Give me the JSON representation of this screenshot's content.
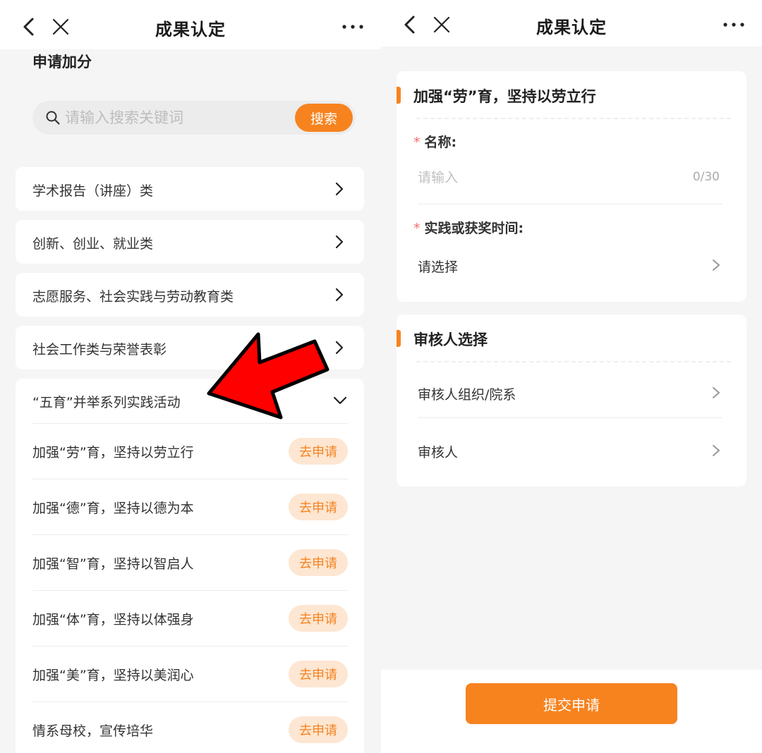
{
  "colors": {
    "accent": "#f7831f",
    "accent_light": "#fde6d2",
    "required": "#f56c6c",
    "annotation": "#ff0000"
  },
  "left": {
    "nav": {
      "title": "成果认定"
    },
    "section_title": "申请加分",
    "search": {
      "placeholder": "请输入搜索关键词",
      "value": "",
      "button_label": "搜索"
    },
    "categories": [
      {
        "label": "学术报告（讲座）类"
      },
      {
        "label": "创新、创业、就业类"
      },
      {
        "label": "志愿服务、社会实践与劳动教育类"
      },
      {
        "label": "社会工作类与荣誉表彰"
      }
    ],
    "expanded_category": {
      "label": "“五育”并举系列实践活动",
      "items": [
        {
          "label": "加强“劳”育，坚持以劳立行",
          "button": "去申请"
        },
        {
          "label": "加强“德”育，坚持以德为本",
          "button": "去申请"
        },
        {
          "label": "加强“智”育，坚持以智启人",
          "button": "去申请"
        },
        {
          "label": "加强“体”育，坚持以体强身",
          "button": "去申请"
        },
        {
          "label": "加强“美”育，坚持以美润心",
          "button": "去申请"
        },
        {
          "label": "情系母校，宣传培华",
          "button": "去申请"
        }
      ]
    }
  },
  "right": {
    "nav": {
      "title": "成果认定"
    },
    "form_card": {
      "title": "加强“劳”育，坚持以劳立行",
      "name_field": {
        "required_mark": "*",
        "label": "名称:",
        "placeholder": "请输入",
        "value": "",
        "counter": "0/30"
      },
      "time_field": {
        "required_mark": "*",
        "label": "实践或获奖时间:",
        "value": "请选择"
      }
    },
    "reviewer_card": {
      "title": "审核人选择",
      "org_label": "审核人组织/院系",
      "reviewer_label": "审核人"
    },
    "submit_label": "提交申请"
  }
}
